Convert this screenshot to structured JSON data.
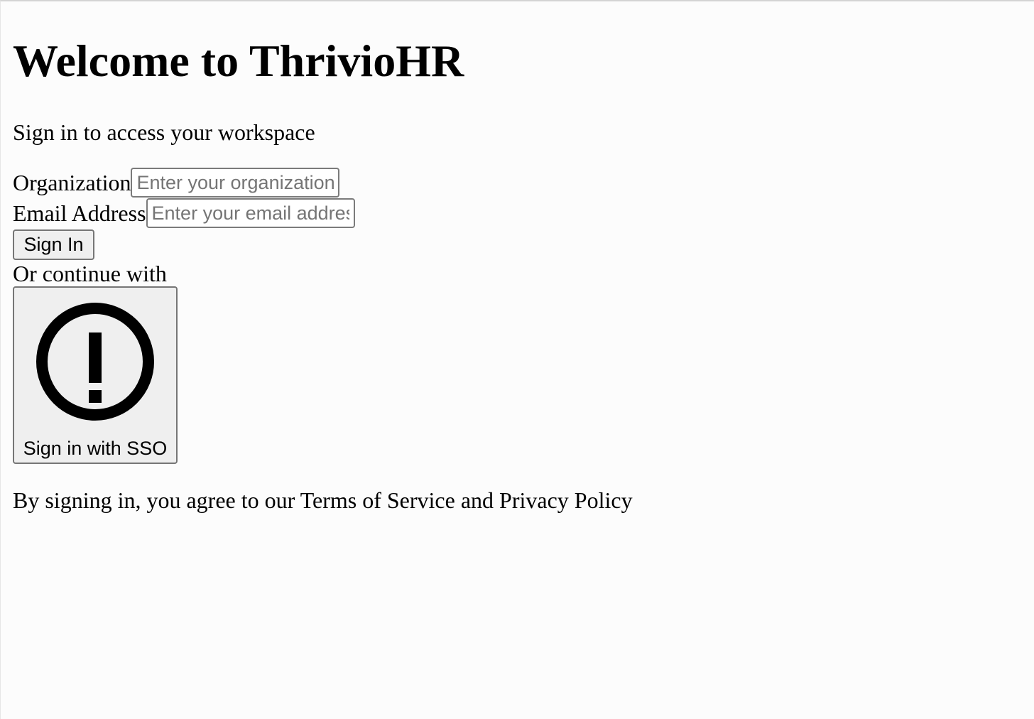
{
  "login": {
    "title": "Welcome to ThrivioHR",
    "subtitle": "Sign in to access your workspace",
    "organization": {
      "label": "Organization",
      "placeholder": "Enter your organization",
      "value": ""
    },
    "email": {
      "label": "Email Address",
      "placeholder": "Enter your email address",
      "value": ""
    },
    "sign_in_label": "Sign In",
    "divider_text": "Or continue with",
    "sso": {
      "label": "Sign in with SSO",
      "icon": "alert-circle-icon"
    },
    "legal_text": "By signing in, you agree to our Terms of Service and Privacy Policy"
  }
}
